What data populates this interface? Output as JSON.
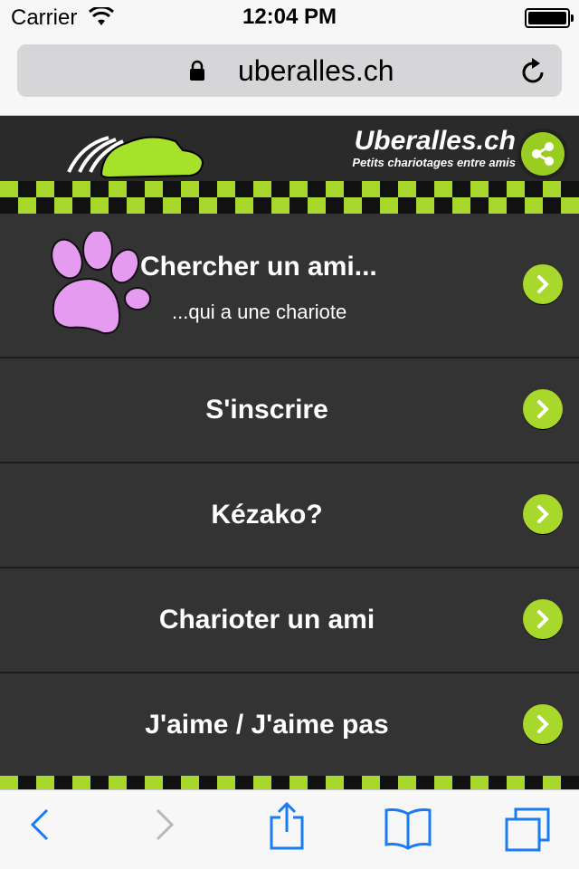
{
  "status": {
    "carrier": "Carrier",
    "time": "12:04 PM"
  },
  "browser": {
    "url": "uberalles.ch"
  },
  "site": {
    "brand_title": "Uberalles.ch",
    "brand_subtitle": "Petits chariotages entre amis",
    "accent_color": "#a8d82b",
    "menu": [
      {
        "label": "Chercher un ami...",
        "sub": "...qui a une chariote",
        "icon": "paw-icon"
      },
      {
        "label": "S'inscrire"
      },
      {
        "label": "Kézako?"
      },
      {
        "label": "Charioter un ami"
      },
      {
        "label": "J'aime / J'aime pas"
      }
    ]
  },
  "icons": {
    "wifi": "wifi-icon",
    "lock": "lock-icon",
    "reload": "reload-icon",
    "share": "share-icon",
    "arrow": "chevron-right-icon",
    "back": "back-icon",
    "forward": "forward-icon",
    "action": "share-action-icon",
    "bookmarks": "bookmarks-icon",
    "tabs": "tabs-icon"
  }
}
